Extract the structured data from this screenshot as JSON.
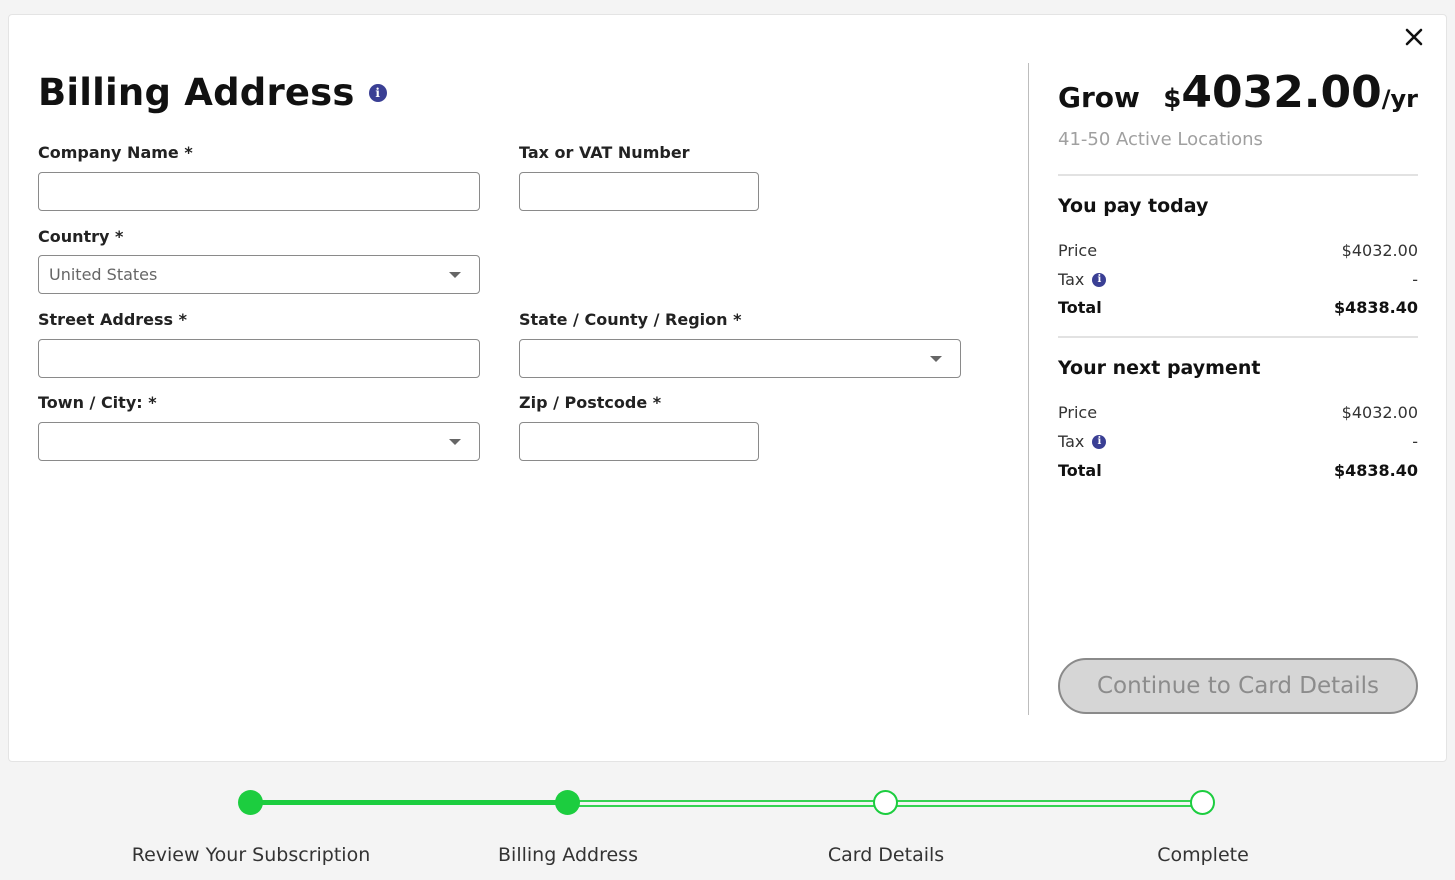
{
  "form": {
    "title": "Billing Address",
    "company_name": {
      "label": "Company Name *",
      "value": ""
    },
    "tax_vat": {
      "label": "Tax or VAT Number",
      "value": ""
    },
    "country": {
      "label": "Country *",
      "value": "United States"
    },
    "street_address": {
      "label": "Street Address *",
      "value": ""
    },
    "state": {
      "label": "State / County / Region *",
      "value": ""
    },
    "town_city": {
      "label": "Town / City: *",
      "value": ""
    },
    "zip": {
      "label": "Zip / Postcode *",
      "value": ""
    }
  },
  "plan": {
    "name": "Grow",
    "currency": "$",
    "amount": "4032.00",
    "period": "/yr",
    "subtitle": "41-50 Active Locations"
  },
  "pay_today": {
    "title": "You pay today",
    "price_label": "Price",
    "price_value": "$4032.00",
    "tax_label": "Tax",
    "tax_value": "-",
    "total_label": "Total",
    "total_value": "$4838.40"
  },
  "next_payment": {
    "title": "Your next payment",
    "price_label": "Price",
    "price_value": "$4032.00",
    "tax_label": "Tax",
    "tax_value": "-",
    "total_label": "Total",
    "total_value": "$4838.40"
  },
  "continue_label": "Continue to Card Details",
  "steps": [
    {
      "label": "Review Your Subscription",
      "state": "done"
    },
    {
      "label": "Billing Address",
      "state": "current"
    },
    {
      "label": "Card Details",
      "state": "pending"
    },
    {
      "label": "Complete",
      "state": "pending"
    }
  ],
  "icons": {
    "close": "close-icon",
    "info": "info-icon",
    "dropdown": "chevron-down-icon"
  },
  "colors": {
    "accent": "#1ccd3f",
    "info": "#3a3f94",
    "button_bg": "#d6d6d6"
  }
}
